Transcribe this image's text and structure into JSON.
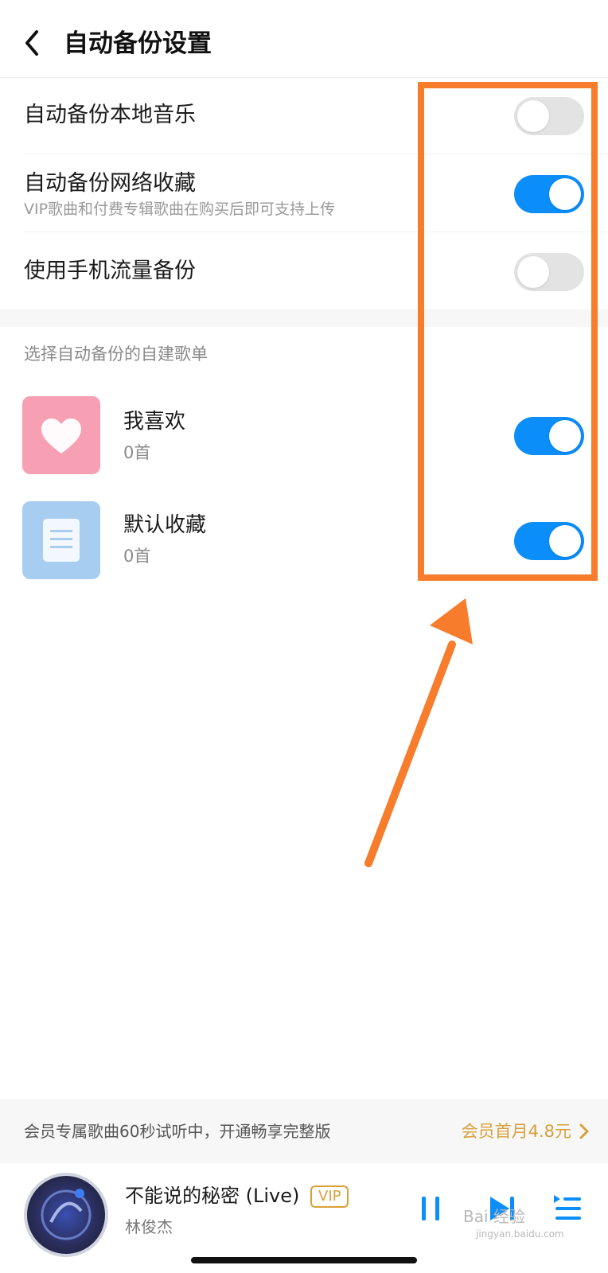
{
  "header": {
    "title": "自动备份设置"
  },
  "settings": [
    {
      "label": "自动备份本地音乐",
      "subtitle": "",
      "enabled": false
    },
    {
      "label": "自动备份网络收藏",
      "subtitle": "VIP歌曲和付费专辑歌曲在购买后即可支持上传",
      "enabled": true
    },
    {
      "label": "使用手机流量备份",
      "subtitle": "",
      "enabled": false
    }
  ],
  "playlists_section": {
    "title": "选择自动备份的自建歌单",
    "items": [
      {
        "name": "我喜欢",
        "count": "0首",
        "enabled": true,
        "icon": "heart-icon"
      },
      {
        "name": "默认收藏",
        "count": "0首",
        "enabled": true,
        "icon": "document-icon"
      }
    ]
  },
  "promo": {
    "text": "会员专属歌曲60秒试听中，开通畅享完整版",
    "link": "会员首月4.8元"
  },
  "player": {
    "song": "不能说的秘密 (Live)",
    "badge": "VIP",
    "artist": "林俊杰",
    "controls": [
      "pause-icon",
      "next-icon",
      "playlist-icon"
    ]
  },
  "watermark": {
    "text": "Bai 经验",
    "sub": "jingyan.baidu.com"
  },
  "colors": {
    "toggle_on": "#0b8dfa",
    "toggle_off": "#e3e3e3",
    "highlight": "#f77c2b",
    "gold": "#d9a03a"
  }
}
